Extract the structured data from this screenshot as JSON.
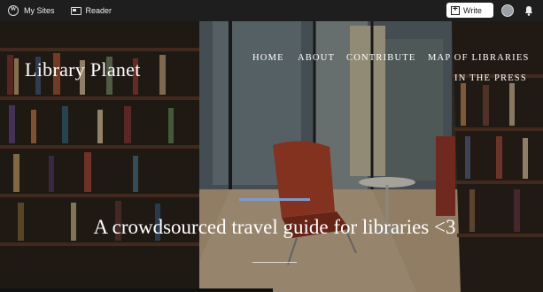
{
  "admin_bar": {
    "my_sites_label": "My Sites",
    "reader_label": "Reader",
    "write_label": "Write"
  },
  "site": {
    "title": "Library Planet",
    "tagline": "A crowdsourced travel guide for libraries <3"
  },
  "nav": {
    "items": [
      {
        "label": "HOME"
      },
      {
        "label": "ABOUT"
      },
      {
        "label": "CONTRIBUTE"
      },
      {
        "label": "MAP OF LIBRARIES"
      },
      {
        "label": "IN THE PRESS"
      }
    ]
  },
  "colors": {
    "admin_bar_bg": "#1e1e1e",
    "accent_line": "#7b9bd0",
    "chair": "#b5462a"
  },
  "icons": [
    "wordpress-logo-icon",
    "reader-icon",
    "write-icon",
    "avatar",
    "notifications-bell-icon"
  ]
}
